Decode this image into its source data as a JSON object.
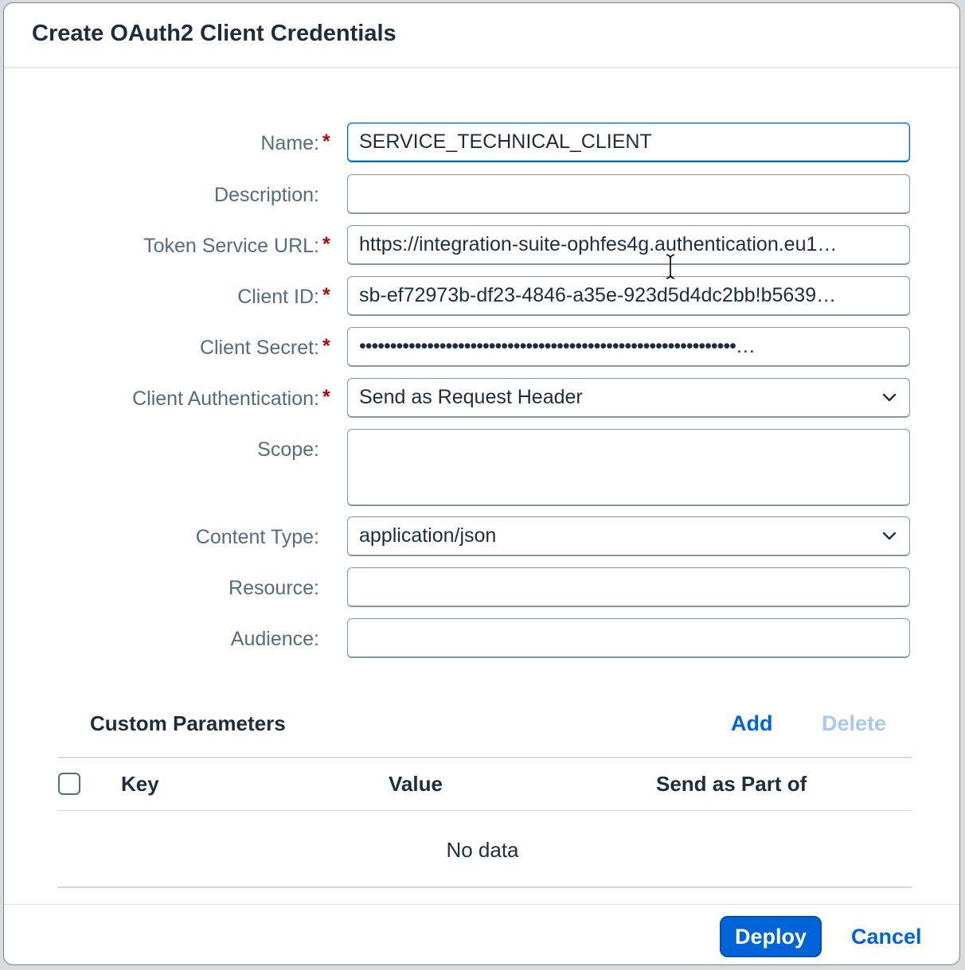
{
  "dialog": {
    "title": "Create OAuth2 Client Credentials"
  },
  "colors": {
    "accent": "#0064d9",
    "required": "#aa0808",
    "label": "#556b82",
    "text": "#1d2d3e",
    "disabled": "#a8c9ee"
  },
  "form": {
    "name": {
      "label": "Name:",
      "required_mark": "*",
      "value": "SERVICE_TECHNICAL_CLIENT"
    },
    "description": {
      "label": "Description:",
      "value": ""
    },
    "token_url": {
      "label": "Token Service URL:",
      "required_mark": "*",
      "value": "https://integration-suite-ophfes4g.authentication.eu1…"
    },
    "client_id": {
      "label": "Client ID:",
      "required_mark": "*",
      "value": "sb-ef72973b-df23-4846-a35e-923d5d4dc2bb!b5639…"
    },
    "client_secret": {
      "label": "Client Secret:",
      "required_mark": "*",
      "value": "•••••••••••••••••••••••••••••••••••••••••••••••••••••••••••••…"
    },
    "client_auth": {
      "label": "Client Authentication:",
      "required_mark": "*",
      "value": "Send as Request Header",
      "icon": "chevron-down-icon"
    },
    "scope": {
      "label": "Scope:",
      "value": ""
    },
    "content_type": {
      "label": "Content Type:",
      "value": "application/json",
      "icon": "chevron-down-icon"
    },
    "resource": {
      "label": "Resource:",
      "value": ""
    },
    "audience": {
      "label": "Audience:",
      "value": ""
    }
  },
  "custom_params": {
    "title": "Custom Parameters",
    "add_label": "Add",
    "delete_label": "Delete",
    "columns": [
      "Key",
      "Value",
      "Send as Part of"
    ],
    "empty_text": "No data"
  },
  "footer": {
    "deploy_label": "Deploy",
    "cancel_label": "Cancel"
  }
}
